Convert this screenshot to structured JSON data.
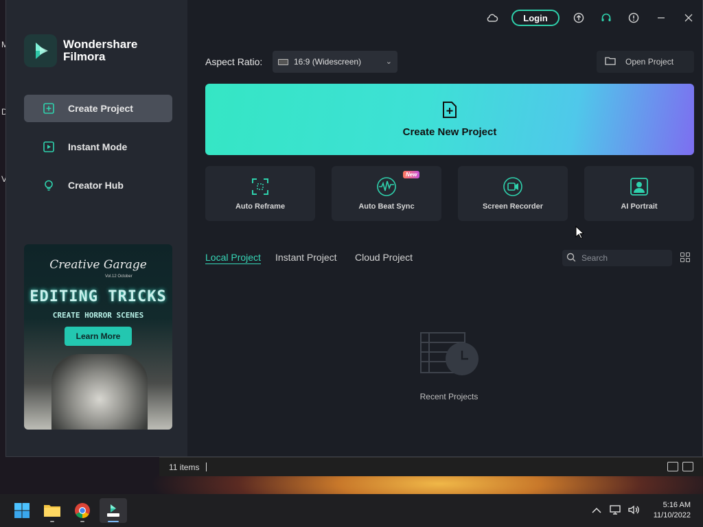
{
  "desktop": {
    "letters": [
      "M",
      "D",
      "V"
    ]
  },
  "explorer": {
    "item_count": "11 items"
  },
  "app": {
    "brand_line1": "Wondershare",
    "brand_line2": "Filmora",
    "accent_color": "#2fd2ad"
  },
  "titlebar": {
    "login_label": "Login"
  },
  "sidebar": {
    "items": [
      {
        "label": "Create Project",
        "icon": "plus-square-icon",
        "active": true
      },
      {
        "label": "Instant Mode",
        "icon": "instant-mode-icon",
        "active": false
      },
      {
        "label": "Creator Hub",
        "icon": "lightbulb-icon",
        "active": false
      }
    ]
  },
  "promo": {
    "script_title": "Creative Garage",
    "subtitle": "Vol.12 October",
    "headline": "EDITING TRICKS",
    "caption": "CREATE HORROR SCENES",
    "button_label": "Learn More"
  },
  "toolbar": {
    "aspect_label": "Aspect Ratio:",
    "aspect_value": "16:9 (Widescreen)",
    "open_project_label": "Open Project"
  },
  "create": {
    "label": "Create New Project"
  },
  "tools": [
    {
      "label": "Auto Reframe",
      "icon": "reframe-icon"
    },
    {
      "label": "Auto Beat Sync",
      "icon": "beat-sync-icon",
      "badge": "New"
    },
    {
      "label": "Screen Recorder",
      "icon": "screen-recorder-icon"
    },
    {
      "label": "AI Portrait",
      "icon": "ai-portrait-icon"
    }
  ],
  "tabs": [
    {
      "label": "Local Project",
      "active": true
    },
    {
      "label": "Instant Project",
      "active": false
    },
    {
      "label": "Cloud Project",
      "active": false
    }
  ],
  "search": {
    "placeholder": "Search"
  },
  "empty": {
    "label": "Recent Projects"
  },
  "clock": {
    "time": "5:16 AM",
    "date": "11/10/2022"
  }
}
